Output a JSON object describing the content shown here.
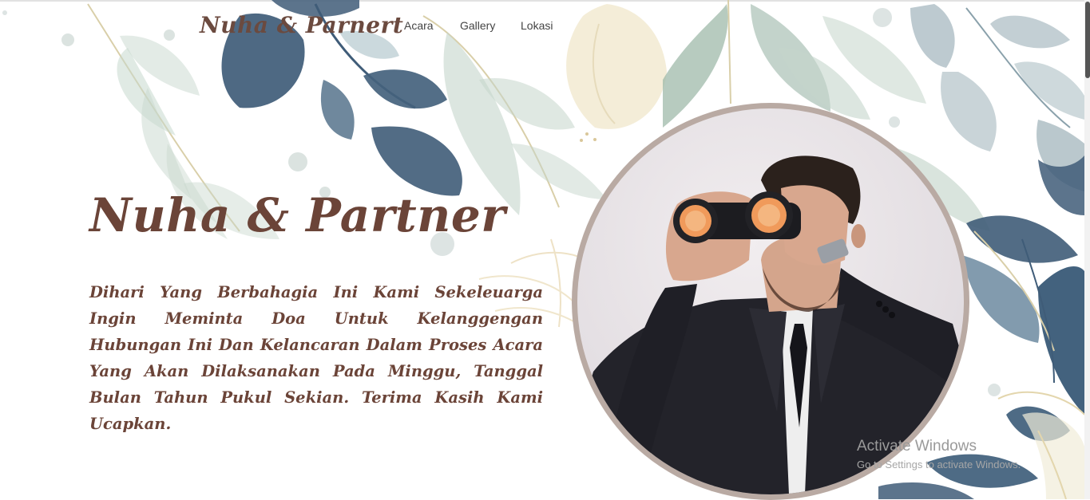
{
  "navbar": {
    "brand": "Nuha & Parnert",
    "links": [
      {
        "label": "Acara"
      },
      {
        "label": "Gallery"
      },
      {
        "label": "Lokasi"
      }
    ]
  },
  "hero": {
    "title": "Nuha & Partner",
    "message": "Dihari Yang Berbahagia Ini Kami Sekeleuarga Ingin Meminta Doa Untuk Kelanggengan Hubungan Ini Dan Kelancaran Dalam Proses Acara Yang Akan Dilaksanakan Pada Minggu, Tanggal Bulan Tahun Pukul Sekian. Terima Kasih Kami Ucapkan."
  },
  "watermark": {
    "title": "Activate Windows",
    "subtitle": "Go to Settings to activate Windows."
  },
  "colors": {
    "brand_text": "#6b4438",
    "leaf_dark": "#3f5c78",
    "leaf_sage": "#b9ccc0",
    "photo_border": "#b9aaa3"
  }
}
